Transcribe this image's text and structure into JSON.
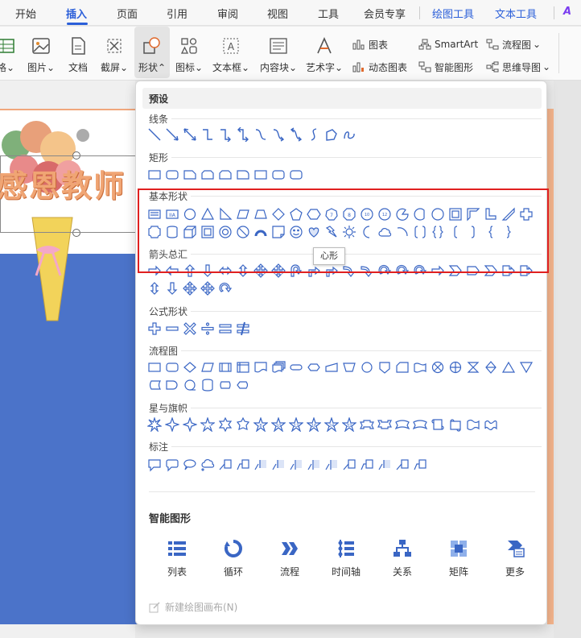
{
  "menubar": {
    "items": [
      {
        "label": "开始",
        "active": false
      },
      {
        "label": "插入",
        "active": true
      },
      {
        "label": "页面",
        "active": false
      },
      {
        "label": "引用",
        "active": false
      },
      {
        "label": "审阅",
        "active": false
      },
      {
        "label": "视图",
        "active": false
      },
      {
        "label": "工具",
        "active": false
      },
      {
        "label": "会员专享",
        "active": false
      }
    ],
    "context_tabs": [
      "绘图工具",
      "文本工具"
    ],
    "accent": "#2b5fd9"
  },
  "ribbon": {
    "buttons": [
      {
        "label": "格",
        "icon": "table-icon"
      },
      {
        "label": "图片",
        "icon": "picture-icon"
      },
      {
        "label": "文档",
        "icon": "document-icon"
      },
      {
        "label": "截屏",
        "icon": "screenshot-icon"
      },
      {
        "label": "形状",
        "icon": "shapes-icon"
      },
      {
        "label": "图标",
        "icon": "icons-icon"
      },
      {
        "label": "文本框",
        "icon": "textbox-icon"
      },
      {
        "label": "内容块",
        "icon": "content-block-icon"
      },
      {
        "label": "艺术字",
        "icon": "wordart-icon"
      }
    ],
    "small": {
      "chart": "图表",
      "dynamic_chart": "动态图表",
      "smartart": "SmartArt",
      "smart_graphic": "智能图形",
      "flowchart": "流程图",
      "mindmap": "思维导图"
    }
  },
  "slide": {
    "title": "感恩教师"
  },
  "shapes_dropdown": {
    "header": "预设",
    "sections": {
      "lines": "线条",
      "rect": "矩形",
      "basic": "基本形状",
      "arrows": "箭头总汇",
      "equation": "公式形状",
      "flowchart": "流程图",
      "stars": "星与旗帜",
      "callouts": "标注"
    },
    "tooltip": "心形",
    "smart_title": "智能图形",
    "smart_items": [
      {
        "label": "列表",
        "icon": "list-icon"
      },
      {
        "label": "循环",
        "icon": "cycle-icon"
      },
      {
        "label": "流程",
        "icon": "process-icon"
      },
      {
        "label": "时间轴",
        "icon": "timeline-icon"
      },
      {
        "label": "关系",
        "icon": "hierarchy-icon"
      },
      {
        "label": "矩阵",
        "icon": "matrix-icon"
      },
      {
        "label": "更多",
        "icon": "more-icon"
      }
    ],
    "new_canvas": "新建绘图画布(N)",
    "highlight_color": "#e02020",
    "shape_color": "#3a66c4"
  }
}
